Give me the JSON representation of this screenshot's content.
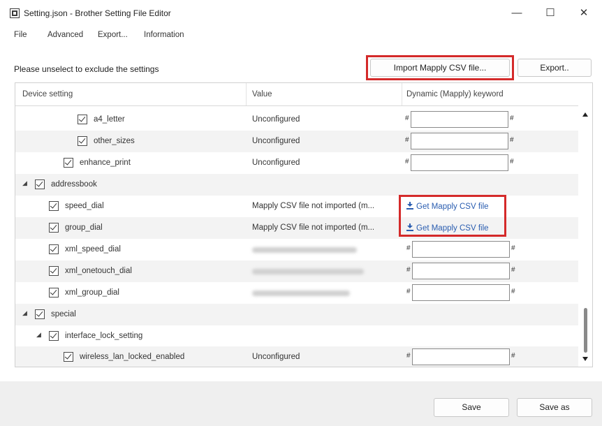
{
  "window": {
    "title": "Setting.json - Brother Setting File Editor",
    "minimize": "—",
    "maximize": "☐",
    "close": "✕"
  },
  "menu": [
    "File",
    "Advanced",
    "Export...",
    "Information"
  ],
  "hint": "Please unselect to exclude the settings",
  "buttons": {
    "import": "Import Mapply CSV file...",
    "export": "Export..",
    "save": "Save",
    "save_as": "Save as"
  },
  "columns": {
    "device_setting": "Device setting",
    "value": "Value",
    "keyword": "Dynamic (Mapply) keyword"
  },
  "hash": "#",
  "get_mapply_label": "Get Mapply CSV file",
  "rows": [
    {
      "name": "a4_letter",
      "value": "Unconfigured"
    },
    {
      "name": "other_sizes",
      "value": "Unconfigured"
    },
    {
      "name": "enhance_print",
      "value": "Unconfigured"
    },
    {
      "name": "addressbook",
      "value": ""
    },
    {
      "name": "speed_dial",
      "value": "Mapply CSV file not imported (m..."
    },
    {
      "name": "group_dial",
      "value": "Mapply CSV file not imported (m..."
    },
    {
      "name": "xml_speed_dial",
      "value": ""
    },
    {
      "name": "xml_onetouch_dial",
      "value": ""
    },
    {
      "name": "xml_group_dial",
      "value": ""
    },
    {
      "name": "special",
      "value": ""
    },
    {
      "name": "interface_lock_setting",
      "value": ""
    },
    {
      "name": "wireless_lan_locked_enabled",
      "value": "Unconfigured"
    }
  ],
  "icons": {
    "expand": "◢",
    "download": "download-icon"
  }
}
